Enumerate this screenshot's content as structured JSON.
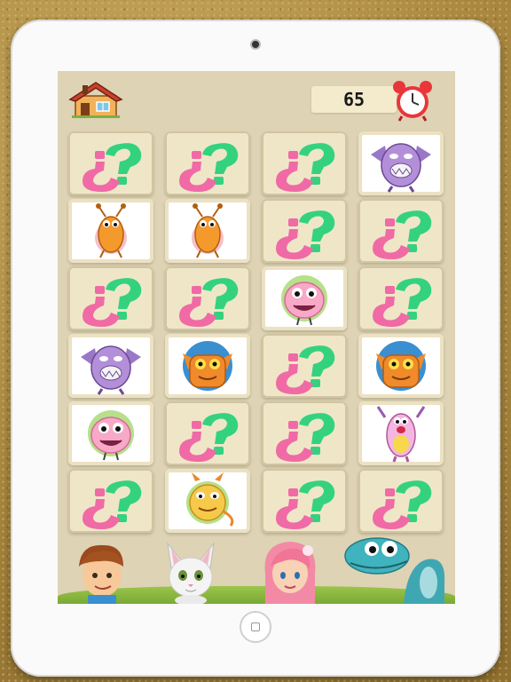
{
  "timer": {
    "value": "65",
    "icon": "alarm-clock-icon"
  },
  "home": {
    "icon": "house-icon"
  },
  "colors": {
    "question_pink": "#f06aa5",
    "question_green": "#34d27f",
    "board_bg": "#ded3b4",
    "card_bg": "#efe6c8"
  },
  "board": {
    "rows": 6,
    "cols": 4,
    "cards": [
      "hidden",
      "hidden",
      "hidden",
      "purple-bat-monster",
      "orange-bug-monster",
      "orange-bug-monster",
      "hidden",
      "hidden",
      "hidden",
      "hidden",
      "pink-furry-monster",
      "hidden",
      "purple-bat-monster",
      "orange-goblin-monster",
      "hidden",
      "orange-goblin-monster",
      "pink-furry-monster",
      "hidden",
      "hidden",
      "pink-tall-monster",
      "hidden",
      "yellow-horned-monster",
      "hidden",
      "hidden"
    ]
  },
  "characters": [
    "boy-character",
    "cat-character",
    "mermaid-character",
    "dinosaur-character"
  ]
}
